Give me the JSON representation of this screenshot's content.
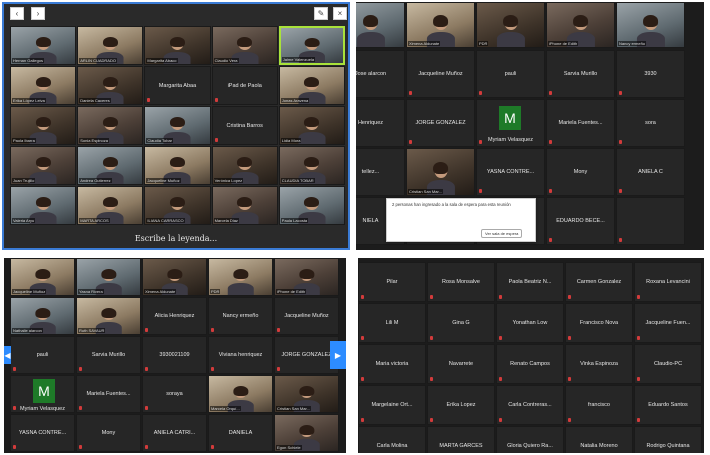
{
  "panel_a": {
    "toolbar_back": "‹",
    "toolbar_fwd": "›",
    "toolbar_close": "×",
    "caption_text": "Escribe la leyenda...",
    "tiles": [
      [
        "Hernan Gallegos",
        "ARLIN CUADRADO",
        "Margarita Abaco",
        "Claudio Vera",
        "Jaime Valenzuela"
      ],
      [
        "Erika López Leiva",
        "Daniela Caceres",
        "Margarita Abaa",
        "iPad de Paola",
        "Jonas Aravena"
      ],
      [
        "Paola Ibarra",
        "Sonia Espinoza",
        "Claudia Tobar",
        "Cristina Barros",
        "Lidia Mora"
      ],
      [
        "Juan Trujillo",
        "Andrea Gutierrez",
        "Jacqueline Muñoz",
        "Verónica Lopez",
        "CLAUDIA TOBAR"
      ],
      [
        "Valeria Aryu",
        "MARTA ARCOS",
        "ILIANA CARRASCO",
        "Marcela Diaz",
        "Paula Lacosta"
      ]
    ]
  },
  "panel_b": {
    "top_row": [
      "",
      "Ximena Aldunate",
      "PDR",
      "iPhone de Edith",
      "Nancy ermeño"
    ],
    "rows": [
      [
        "Jose alarcon",
        "Jacqueline Muñoz",
        "pauli",
        "Sarvia Murillo",
        "3930"
      ],
      [
        "Henriquez",
        "JORGE GONZALEZ",
        "Myriam Velasquez",
        "Mariela  Fuentes...",
        "sora"
      ],
      [
        "tellez...",
        "Cristian San Mar...",
        "YASNA  CONTRE...",
        "Mony",
        "ANIELA C"
      ],
      [
        "NIELA",
        "",
        "",
        "EDUARDO  BECE...",
        ""
      ]
    ],
    "notice_text": "2 personas han ingresado a la sala de espera para esta reunión",
    "notice_button": "Ver sala de espera",
    "avatar_letter": "M"
  },
  "panel_c": {
    "top_row": [
      "Jacqueline Muñoz",
      "Yasna Rivera",
      "Ximena Aldunate",
      "PDR",
      "iPhone de Edith"
    ],
    "rows": [
      [
        "Nathalie alarcon",
        "Ruth SAVAUR",
        "Alicia Henriquez",
        "Nancy ermeño",
        "Jacqueline Muñoz"
      ],
      [
        "pauli",
        "Sarvia Murillo",
        "3930021109",
        "Viviana henriquez",
        "JORGE GONZALEZ"
      ],
      [
        "Myriam Velasquez",
        "Mariela  Fuentes...",
        "soraya",
        "Marcela Orquí...",
        "Cristian San Mar..."
      ],
      [
        "YASNA  CONTRE...",
        "Mony",
        "ANIELA  CATRI...",
        "DANIELA",
        "Egon Schiele"
      ]
    ],
    "avatar_letter": "M",
    "arrow_left": "◀",
    "arrow_right": "▶"
  },
  "panel_d": {
    "rows": [
      [
        "Pilar",
        "Rosa Monsalve",
        "Paola Beatriz N...",
        "Carmen Gonzalez",
        "Roxana Levancini"
      ],
      [
        "Lili M",
        "Gina G",
        "Yonathan Low",
        "Francisco Nova",
        "Jacqueline  Fuen..."
      ],
      [
        "Maria victoria",
        "Navarrete",
        "Renato Campos",
        "Vinka Espinoza",
        "Claudio-PC"
      ],
      [
        "Margelaine  Ort...",
        "Erika Lopez",
        "Carla  Contreras...",
        "francisco",
        "Eduardo Santos"
      ],
      [
        "Carla Molina",
        "MARTA  GARCES",
        "Gloria  Quiero Ra...",
        "Natalia Moreno",
        "Rodrigo Quintana"
      ]
    ]
  },
  "colors": {
    "frame_blue": "#3a7bd5",
    "speaker_highlight": "#a9e23a",
    "mic_muted": "#d23b3b",
    "avatar_green": "#1e7a28",
    "zoom_blue": "#2d8cff"
  }
}
